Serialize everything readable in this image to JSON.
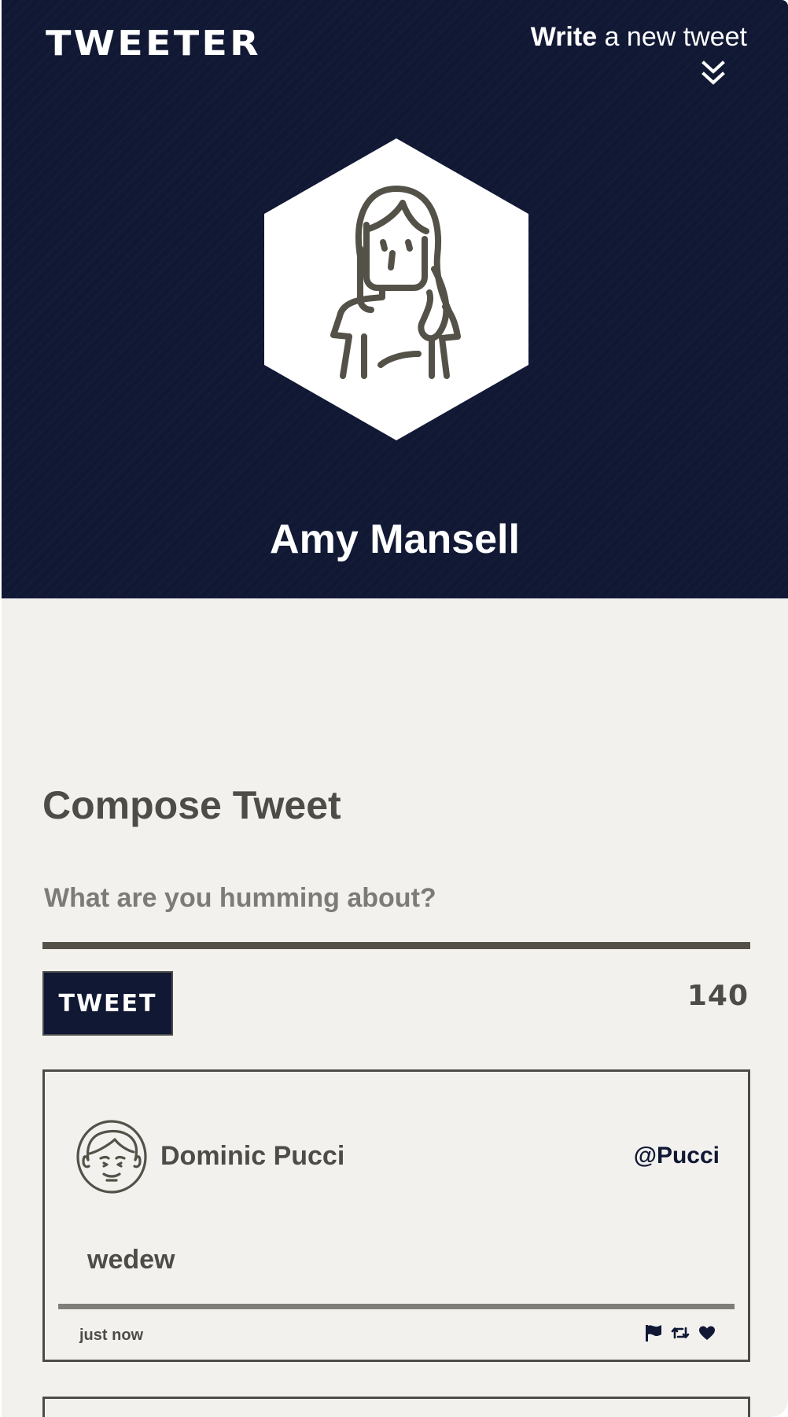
{
  "header": {
    "logo": "TWEETER",
    "write_toggle": {
      "strong": "Write",
      "rest": " a new tweet"
    },
    "profile_name": "Amy Mansell",
    "colors": {
      "navy": "#111834",
      "white": "#ffffff"
    }
  },
  "compose": {
    "title": "Compose Tweet",
    "placeholder": "What are you humming about?",
    "value": "",
    "button_label": "TWEET",
    "counter": "140"
  },
  "tweets": [
    {
      "author": "Dominic Pucci",
      "handle": "@Pucci",
      "content": "wedew",
      "time": "just now",
      "avatar_icon": "man-face-avatar-icon",
      "actions": [
        "flag-icon",
        "retweet-icon",
        "heart-icon"
      ]
    }
  ],
  "theme": {
    "background": "#f2f1ee",
    "text": "#4e4c47",
    "accent": "#111834"
  }
}
